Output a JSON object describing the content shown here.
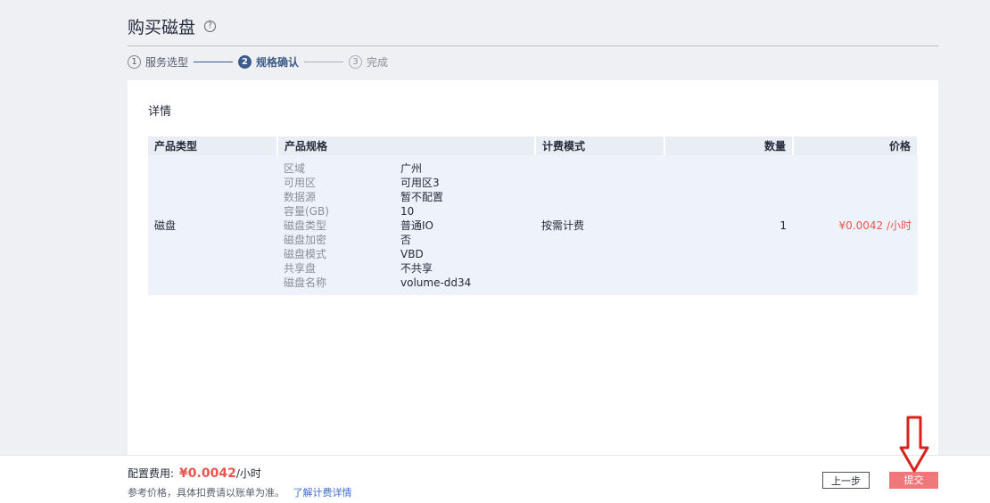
{
  "header": {
    "title": "购买磁盘",
    "help_icon": "?"
  },
  "steps": [
    {
      "num": "1",
      "label": "服务选型",
      "state": "done"
    },
    {
      "num": "2",
      "label": "规格确认",
      "state": "active"
    },
    {
      "num": "3",
      "label": "完成",
      "state": "pending"
    }
  ],
  "details": {
    "title": "详情",
    "columns": [
      "产品类型",
      "产品规格",
      "计费模式",
      "数量",
      "价格"
    ],
    "row": {
      "type": "磁盘",
      "specs": [
        {
          "key": "区域",
          "value": "广州"
        },
        {
          "key": "可用区",
          "value": "可用区3"
        },
        {
          "key": "数据源",
          "value": "暂不配置"
        },
        {
          "key": "容量(GB)",
          "value": "10"
        },
        {
          "key": "磁盘类型",
          "value": "普通IO"
        },
        {
          "key": "磁盘加密",
          "value": "否"
        },
        {
          "key": "磁盘模式",
          "value": "VBD"
        },
        {
          "key": "共享盘",
          "value": "不共享"
        },
        {
          "key": "磁盘名称",
          "value": "volume-dd34"
        }
      ],
      "billing": "按需计费",
      "quantity": "1",
      "price": "¥0.0042 /小时"
    }
  },
  "footer": {
    "fee_label": "配置费用:",
    "fee_amount": "¥0.0042",
    "fee_unit": "/小时",
    "note": "参考价格，具体扣费请以账单为准。",
    "link": "了解计费详情",
    "prev_label": "上一步",
    "submit_label": "提交"
  },
  "colors": {
    "accent": "#3e5a8a",
    "price": "#e9564e",
    "submit": "#f0787a",
    "arrow": "#d9221c"
  }
}
